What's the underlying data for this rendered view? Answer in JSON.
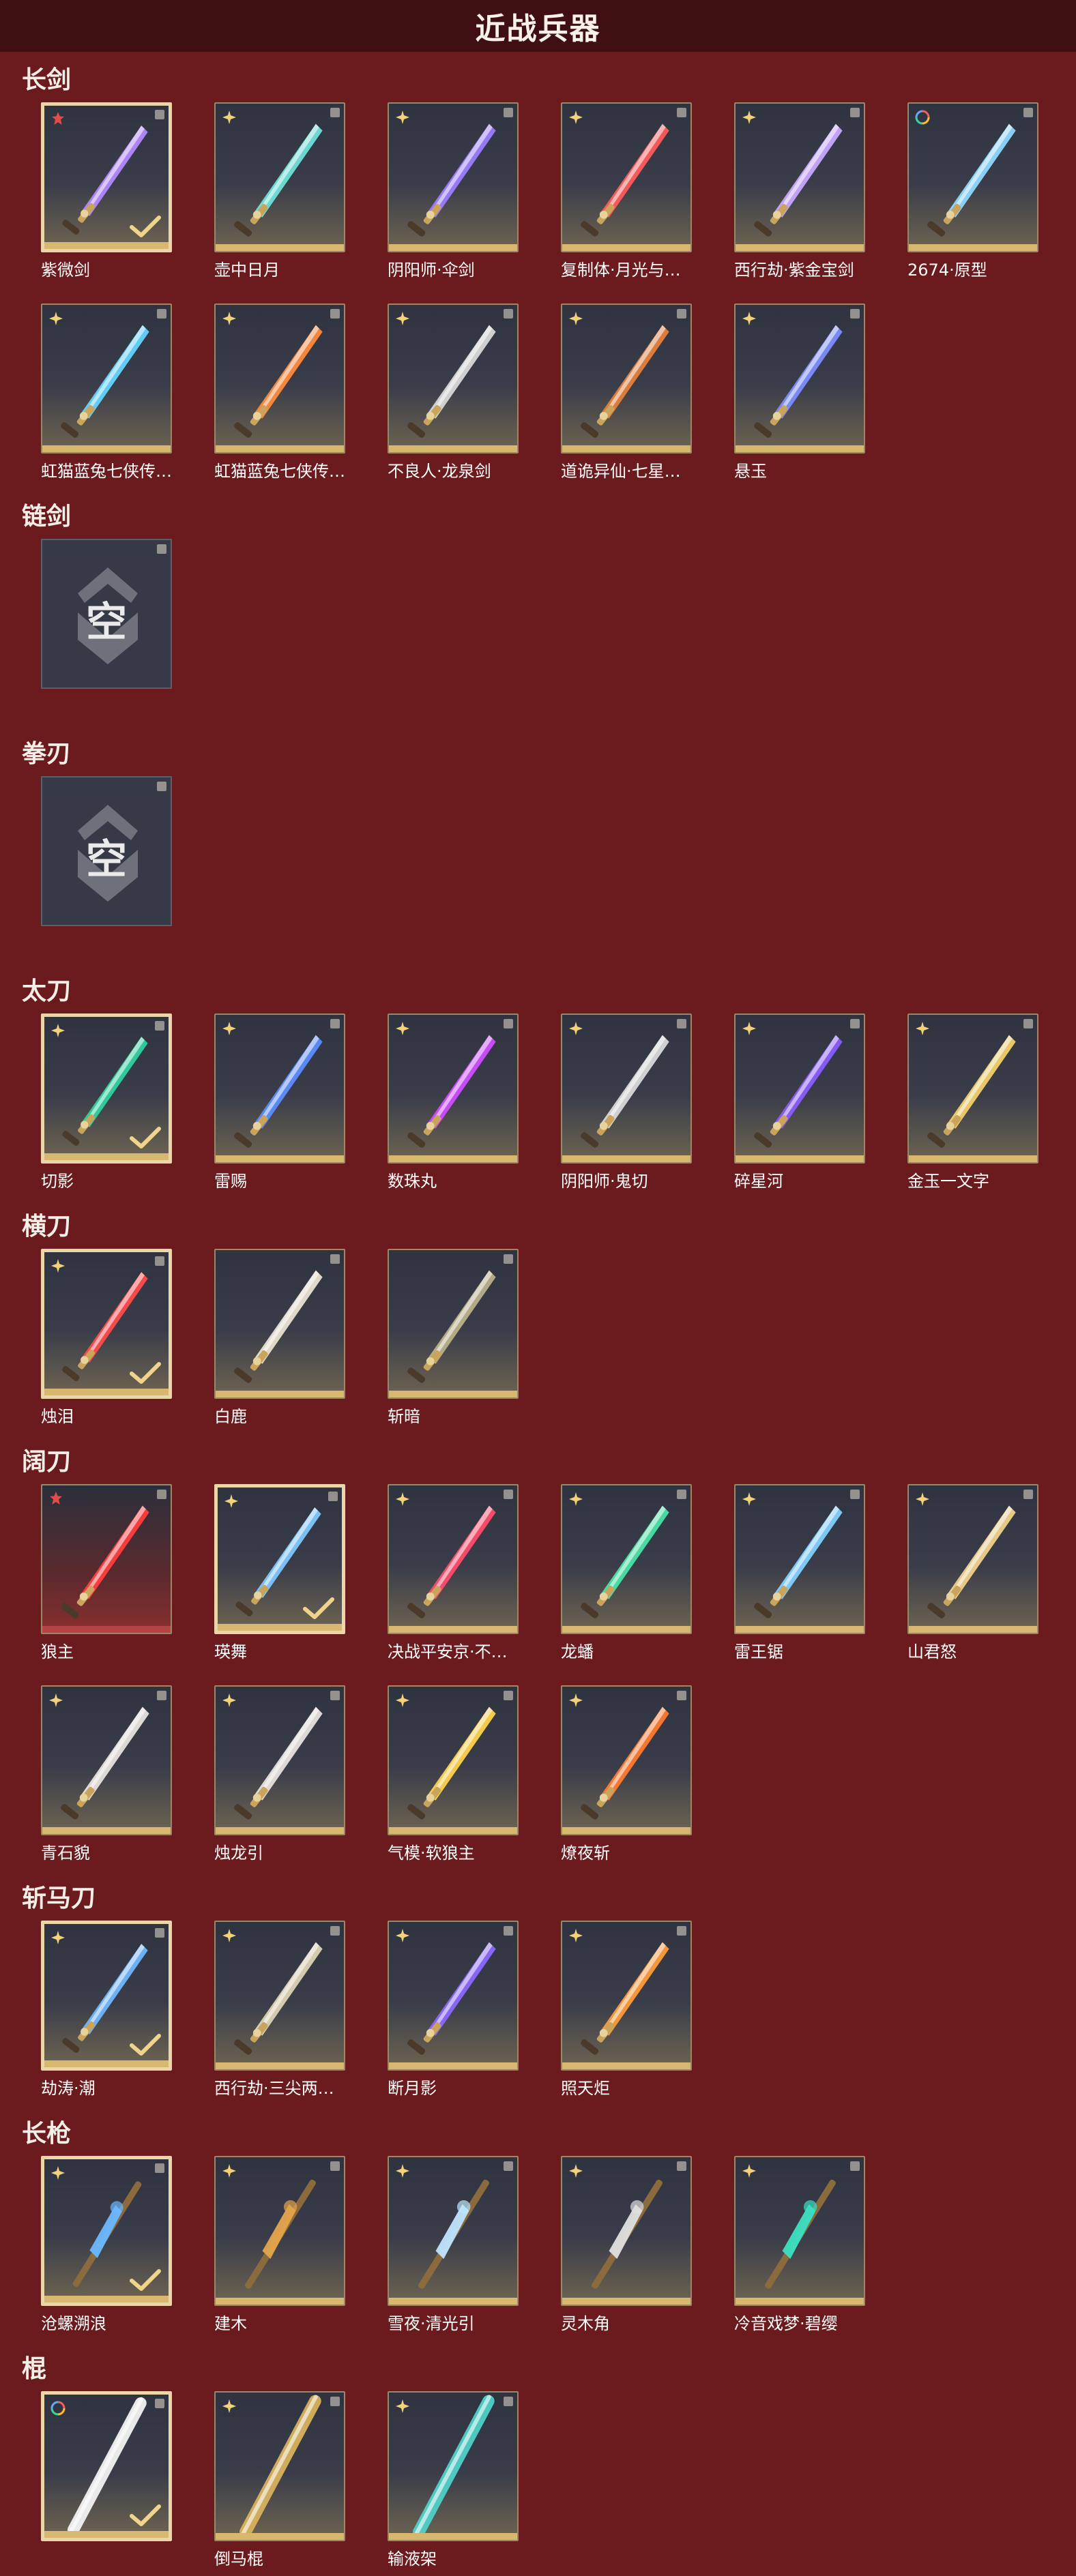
{
  "header": {
    "title": "近战兵器"
  },
  "sections": [
    {
      "key": "changjian",
      "name": "长剑",
      "items": [
        {
          "name": "紫微剑",
          "badge": "red-star",
          "selected": true,
          "accent": "#b388ff"
        },
        {
          "name": "壶中日月",
          "badge": "gold-star",
          "selected": false,
          "accent": "#6ee0d8"
        },
        {
          "name": "阴阳师·伞剑",
          "badge": "gold-star",
          "selected": false,
          "accent": "#9c7cff"
        },
        {
          "name": "复制体·月光与黑暗",
          "badge": "gold-star",
          "selected": false,
          "accent": "#ff5b5b"
        },
        {
          "name": "西行劫·紫金宝剑",
          "badge": "gold-star",
          "selected": false,
          "accent": "#c7a6ff"
        },
        {
          "name": "2674·原型",
          "badge": "rainbow",
          "selected": false,
          "accent": "#8ed7ff"
        },
        {
          "name": "虹猫蓝兔七侠传·冰魄...",
          "badge": "gold-star",
          "selected": false,
          "accent": "#63d4ff"
        },
        {
          "name": "虹猫蓝兔七侠传·长虹...",
          "badge": "gold-star",
          "selected": false,
          "accent": "#ff8a3c"
        },
        {
          "name": "不良人·龙泉剑",
          "badge": "gold-star",
          "selected": false,
          "accent": "#d7d7d7"
        },
        {
          "name": "道诡异仙·七星铜钱剑",
          "badge": "gold-star",
          "selected": false,
          "accent": "#e4803c"
        },
        {
          "name": "悬玉",
          "badge": "gold-star",
          "selected": false,
          "accent": "#7c8cff"
        }
      ]
    },
    {
      "key": "lianjian",
      "name": "链剑",
      "empty_text": "空"
    },
    {
      "key": "quanren",
      "name": "拳刃",
      "empty_text": "空"
    },
    {
      "key": "taidao",
      "name": "太刀",
      "items": [
        {
          "name": "切影",
          "badge": "gold-star",
          "selected": true,
          "accent": "#2fd1a0"
        },
        {
          "name": "雷赐",
          "badge": "gold-star",
          "selected": false,
          "accent": "#5c8dff"
        },
        {
          "name": "数珠丸",
          "badge": "gold-star",
          "selected": false,
          "accent": "#d04dff"
        },
        {
          "name": "阴阳师·鬼切",
          "badge": "gold-star",
          "selected": false,
          "accent": "#d8d8d8"
        },
        {
          "name": "碎星河",
          "badge": "gold-star",
          "selected": false,
          "accent": "#8a5cff"
        },
        {
          "name": "金玉一文字",
          "badge": "gold-star",
          "selected": false,
          "accent": "#f2cf6b"
        }
      ]
    },
    {
      "key": "hengdao",
      "name": "横刀",
      "items": [
        {
          "name": "烛泪",
          "badge": "gold-star",
          "selected": true,
          "accent": "#ff4b4b"
        },
        {
          "name": "白鹿",
          "badge": "none",
          "selected": false,
          "accent": "#e8e2d2"
        },
        {
          "name": "斩暗",
          "badge": "none",
          "selected": false,
          "accent": "#b9b08a"
        }
      ]
    },
    {
      "key": "kuodao",
      "name": "阔刀",
      "items": [
        {
          "name": "狼主",
          "badge": "red-star",
          "selected": false,
          "accent": "#ff3e3e",
          "red": true
        },
        {
          "name": "瑛舞",
          "badge": "gold-star",
          "selected": true,
          "accent": "#7dc7ff"
        },
        {
          "name": "决战平安京·不祥绯刃",
          "badge": "gold-star",
          "selected": false,
          "accent": "#ff4c6c"
        },
        {
          "name": "龙蟠",
          "badge": "gold-star",
          "selected": false,
          "accent": "#48e3a6"
        },
        {
          "name": "雷王锯",
          "badge": "gold-star",
          "selected": false,
          "accent": "#7fd0ff"
        },
        {
          "name": "山君怒",
          "badge": "gold-star",
          "selected": false,
          "accent": "#f0d08b"
        },
        {
          "name": "青石貌",
          "badge": "gold-star",
          "selected": false,
          "accent": "#e7e2dd"
        },
        {
          "name": "烛龙引",
          "badge": "gold-star",
          "selected": false,
          "accent": "#e7e2dd"
        },
        {
          "name": "气模·软狼主",
          "badge": "gold-star",
          "selected": false,
          "accent": "#ffd24a"
        },
        {
          "name": "燎夜斩",
          "badge": "gold-star",
          "selected": false,
          "accent": "#ff7a2f"
        }
      ]
    },
    {
      "key": "zhanmadao",
      "name": "斩马刀",
      "items": [
        {
          "name": "劫涛·潮",
          "badge": "gold-star",
          "selected": true,
          "accent": "#6fb6ff"
        },
        {
          "name": "西行劫·三尖两刃刀",
          "badge": "gold-star",
          "selected": false,
          "accent": "#dcd3b4"
        },
        {
          "name": "断月影",
          "badge": "gold-star",
          "selected": false,
          "accent": "#8b68ff"
        },
        {
          "name": "照天炬",
          "badge": "gold-star",
          "selected": false,
          "accent": "#ff9b3a"
        }
      ]
    },
    {
      "key": "changqiang",
      "name": "长枪",
      "items": [
        {
          "name": "沧螺溯浪",
          "badge": "gold-star",
          "selected": true,
          "accent": "#6bb8ff"
        },
        {
          "name": "建木",
          "badge": "gold-star",
          "selected": false,
          "accent": "#e5a44c"
        },
        {
          "name": "雪夜·清光引",
          "badge": "gold-star",
          "selected": false,
          "accent": "#bfe5ff"
        },
        {
          "name": "灵木角",
          "badge": "gold-star",
          "selected": false,
          "accent": "#e0e0e0"
        },
        {
          "name": "冷音戏梦·碧缨",
          "badge": "gold-star",
          "selected": false,
          "accent": "#3be0c2"
        }
      ]
    },
    {
      "key": "gun",
      "name": "棍",
      "items": [
        {
          "name": "",
          "badge": "rainbow",
          "selected": true,
          "accent": "#f2f2f2"
        },
        {
          "name": "倒马棍",
          "badge": "gold-star",
          "selected": false,
          "accent": "#d7b25d"
        },
        {
          "name": "输液架",
          "badge": "gold-star",
          "selected": false,
          "accent": "#4fd0c8"
        }
      ]
    }
  ]
}
